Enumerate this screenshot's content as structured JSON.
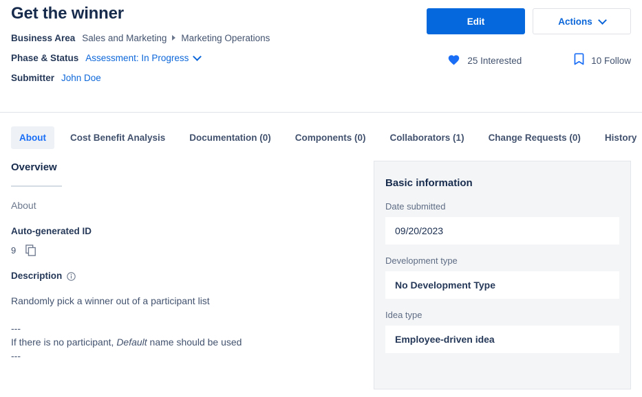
{
  "header": {
    "title": "Get the winner",
    "business_area": {
      "label": "Business Area",
      "parent": "Sales and Marketing",
      "child": "Marketing Operations"
    },
    "phase_status": {
      "label": "Phase & Status",
      "value": "Assessment: In Progress"
    },
    "submitter": {
      "label": "Submitter",
      "value": "John Doe"
    },
    "buttons": {
      "edit": "Edit",
      "actions": "Actions"
    },
    "social": {
      "interested": "25 Interested",
      "follow": "10 Follow"
    }
  },
  "tabs": [
    {
      "label": "About",
      "active": true
    },
    {
      "label": "Cost Benefit Analysis",
      "active": false
    },
    {
      "label": "Documentation (0)",
      "active": false
    },
    {
      "label": "Components (0)",
      "active": false
    },
    {
      "label": "Collaborators (1)",
      "active": false
    },
    {
      "label": "Change Requests (0)",
      "active": false
    },
    {
      "label": "History",
      "active": false
    }
  ],
  "overview": {
    "section_title": "Overview",
    "about_label": "About",
    "auto_id_label": "Auto-generated ID",
    "auto_id_value": "9",
    "description_label": "Description",
    "description_line1": "Randomly pick a winner out of a participant list",
    "description_line2": "---",
    "description_line3_pre": "If there is no participant, ",
    "description_line3_em": "Default",
    "description_line3_post": " name should be used",
    "description_line4": "---"
  },
  "basic_information": {
    "title": "Basic information",
    "fields": [
      {
        "label": "Date submitted",
        "value": "09/20/2023"
      },
      {
        "label": "Development type",
        "value": "No Development Type"
      },
      {
        "label": "Idea type",
        "value": "Employee-driven idea"
      }
    ]
  },
  "colors": {
    "primary_blue": "#0668dd",
    "link_blue": "#0b66d9",
    "active_tab_blue": "#1a6ef5",
    "panel_bg": "#f4f5f7",
    "text_dark": "#172b4d",
    "text_muted": "#6b778c"
  }
}
